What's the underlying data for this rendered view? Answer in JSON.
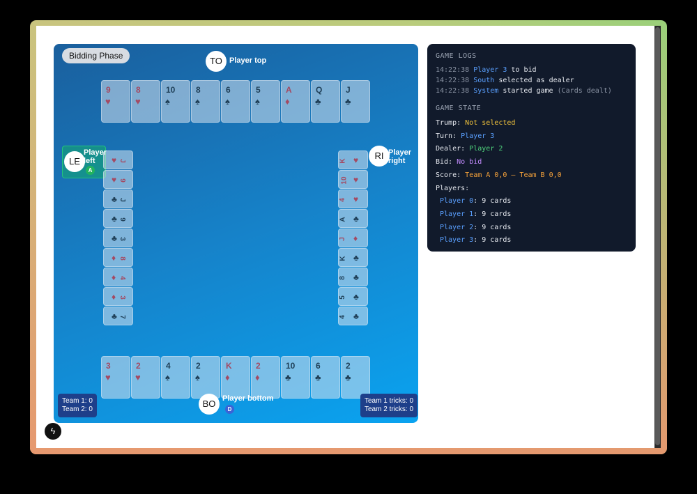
{
  "phase": "Bidding Phase",
  "players": {
    "top": {
      "avatar": "TO",
      "name": "Player top"
    },
    "left": {
      "avatar": "LE",
      "name_line1": "Player",
      "name_line2": "left",
      "badge": "A"
    },
    "right": {
      "avatar": "RI",
      "name_line1": "Player",
      "name_line2": "right"
    },
    "bottom": {
      "avatar": "BO",
      "name": "Player bottom",
      "badge": "D"
    }
  },
  "hands": {
    "top": [
      {
        "rank": "9",
        "suit": "♥",
        "color": "red"
      },
      {
        "rank": "8",
        "suit": "♥",
        "color": "red"
      },
      {
        "rank": "10",
        "suit": "♠",
        "color": "black"
      },
      {
        "rank": "8",
        "suit": "♠",
        "color": "black"
      },
      {
        "rank": "6",
        "suit": "♠",
        "color": "black"
      },
      {
        "rank": "5",
        "suit": "♠",
        "color": "black"
      },
      {
        "rank": "A",
        "suit": "♦",
        "color": "red"
      },
      {
        "rank": "Q",
        "suit": "♣",
        "color": "black"
      },
      {
        "rank": "J",
        "suit": "♣",
        "color": "black"
      }
    ],
    "bottom": [
      {
        "rank": "3",
        "suit": "♥",
        "color": "red"
      },
      {
        "rank": "2",
        "suit": "♥",
        "color": "red"
      },
      {
        "rank": "4",
        "suit": "♠",
        "color": "black"
      },
      {
        "rank": "2",
        "suit": "♠",
        "color": "black"
      },
      {
        "rank": "K",
        "suit": "♦",
        "color": "red"
      },
      {
        "rank": "2",
        "suit": "♦",
        "color": "red"
      },
      {
        "rank": "10",
        "suit": "♣",
        "color": "black"
      },
      {
        "rank": "6",
        "suit": "♣",
        "color": "black"
      },
      {
        "rank": "2",
        "suit": "♣",
        "color": "black"
      }
    ],
    "left": [
      {
        "rank": "J",
        "suit": "♥",
        "color": "red"
      },
      {
        "rank": "9",
        "suit": "♥",
        "color": "red"
      },
      {
        "rank": "J",
        "suit": "♣",
        "color": "black"
      },
      {
        "rank": "9",
        "suit": "♣",
        "color": "black"
      },
      {
        "rank": "3",
        "suit": "♣",
        "color": "black"
      },
      {
        "rank": "8",
        "suit": "♦",
        "color": "red"
      },
      {
        "rank": "4",
        "suit": "♦",
        "color": "red"
      },
      {
        "rank": "3",
        "suit": "♦",
        "color": "red"
      },
      {
        "rank": "7",
        "suit": "♣",
        "color": "black"
      }
    ],
    "right": [
      {
        "rank": "K",
        "suit": "♥",
        "color": "red"
      },
      {
        "rank": "10",
        "suit": "♥",
        "color": "red"
      },
      {
        "rank": "4",
        "suit": "♥",
        "color": "red"
      },
      {
        "rank": "A",
        "suit": "♣",
        "color": "black"
      },
      {
        "rank": "J",
        "suit": "♦",
        "color": "red"
      },
      {
        "rank": "K",
        "suit": "♣",
        "color": "black"
      },
      {
        "rank": "8",
        "suit": "♣",
        "color": "black"
      },
      {
        "rank": "5",
        "suit": "♣",
        "color": "black"
      },
      {
        "rank": "4",
        "suit": "♣",
        "color": "black"
      }
    ]
  },
  "teams": {
    "score_line1": "Team 1: 0",
    "score_line2": "Team 2: 0",
    "tricks_line1": "Team 1 tricks: 0",
    "tricks_line2": "Team 2 tricks: 0"
  },
  "panel": {
    "logs_title": "GAME LOGS",
    "logs": [
      {
        "time": "14:22:38",
        "actor": "Player 3",
        "text": " to bid",
        "extra": ""
      },
      {
        "time": "14:22:38",
        "actor": "South",
        "text": " selected as dealer",
        "extra": ""
      },
      {
        "time": "14:22:38",
        "actor": "System",
        "text": " started game ",
        "extra": "(Cards dealt)"
      }
    ],
    "state_title": "GAME STATE",
    "trump_label": "Trump: ",
    "trump_value": "Not selected",
    "turn_label": "Turn: ",
    "turn_value": "Player 3",
    "dealer_label": "Dealer: ",
    "dealer_value": "Player 2",
    "bid_label": "Bid: ",
    "bid_value": "No bid",
    "score_label": "Score: ",
    "score_value": "Team A 0,0 – Team B 0,0",
    "players_label": "Players:",
    "player_list": [
      {
        "name": "Player 0",
        "cards": ": 9 cards"
      },
      {
        "name": "Player 1",
        "cards": ": 9 cards"
      },
      {
        "name": "Player 2",
        "cards": ": 9 cards"
      },
      {
        "name": "Player 3",
        "cards": ": 9 cards"
      }
    ]
  },
  "colors": {
    "left_badge": "#22b35e",
    "bottom_badge": "#3a63d6",
    "card_red": "#a34a63",
    "card_black": "#1f3f57"
  },
  "icons": {
    "fab": "lightning-bolt-icon"
  }
}
